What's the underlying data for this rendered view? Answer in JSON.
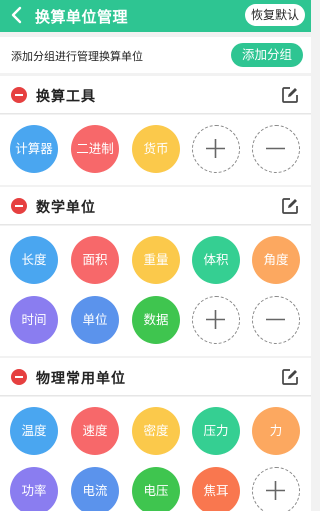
{
  "header": {
    "title": "换算单位管理",
    "reset_label": "恢复默认"
  },
  "hint": {
    "text": "添加分组进行管理换算单位",
    "add_group_label": "添加分组"
  },
  "sections": [
    {
      "title": "换算工具",
      "units": [
        {
          "label": "计算器",
          "color": "#4aa6f0"
        },
        {
          "label": "二进制",
          "color": "#f7686a"
        },
        {
          "label": "货币",
          "color": "#fbc94b"
        }
      ]
    },
    {
      "title": "数学单位",
      "units": [
        {
          "label": "长度",
          "color": "#4aa6f0"
        },
        {
          "label": "面积",
          "color": "#f7686a"
        },
        {
          "label": "重量",
          "color": "#fbc94b"
        },
        {
          "label": "体积",
          "color": "#35cf92"
        },
        {
          "label": "角度",
          "color": "#fca860"
        },
        {
          "label": "时间",
          "color": "#8a7df0"
        },
        {
          "label": "单位",
          "color": "#5b93ec"
        },
        {
          "label": "数据",
          "color": "#3fc54f"
        }
      ]
    },
    {
      "title": "物理常用单位",
      "units": [
        {
          "label": "温度",
          "color": "#4aa6f0"
        },
        {
          "label": "速度",
          "color": "#f7686a"
        },
        {
          "label": "密度",
          "color": "#fbc94b"
        },
        {
          "label": "压力",
          "color": "#35cf92"
        },
        {
          "label": "力",
          "color": "#fca860"
        },
        {
          "label": "功率",
          "color": "#8a7df0"
        },
        {
          "label": "电流",
          "color": "#5b93ec"
        },
        {
          "label": "电压",
          "color": "#3fc54f"
        },
        {
          "label": "焦耳",
          "color": "#f9774f"
        }
      ]
    }
  ],
  "icons": {
    "back": "chevron-left-icon",
    "remove": "minus-circle-icon",
    "edit": "edit-icon",
    "add": "plus-icon",
    "subtract": "minus-icon"
  }
}
